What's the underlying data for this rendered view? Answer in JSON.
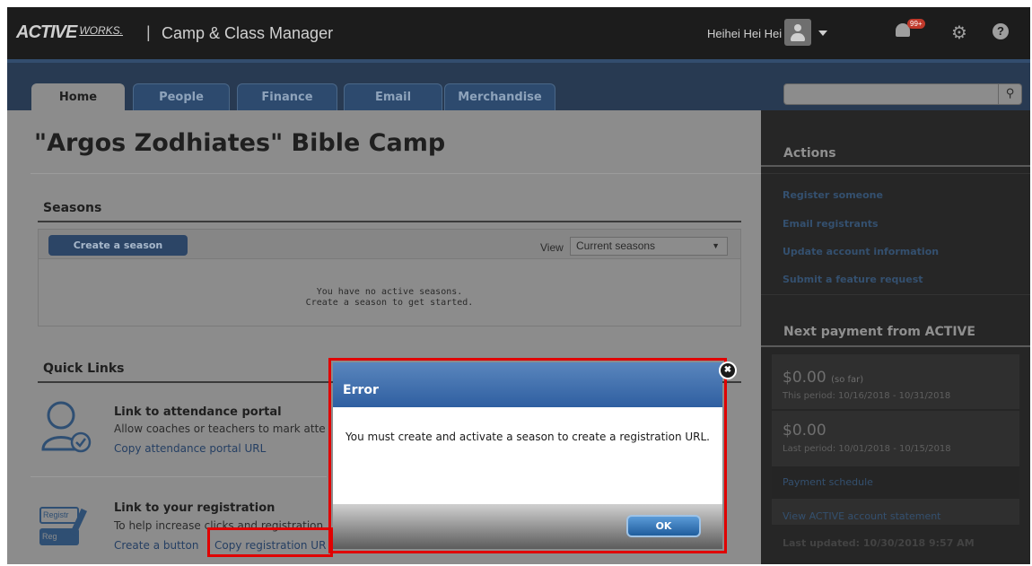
{
  "header": {
    "logo": "ACTIVE",
    "logo_sub": "WORKS.",
    "separator": "|",
    "app_title": "Camp & Class Manager",
    "user_name": "Heihei Hei Hei",
    "notification_count": "99+",
    "help_symbol": "?"
  },
  "nav": {
    "tabs": [
      {
        "label": "Home"
      },
      {
        "label": "People"
      },
      {
        "label": "Finance"
      },
      {
        "label": "Email"
      },
      {
        "label": "Merchandise"
      }
    ],
    "search_placeholder": ""
  },
  "main": {
    "title": "\"Argos Zodhiates\" Bible Camp",
    "seasons": {
      "heading": "Seasons",
      "create_button": "Create a season",
      "view_label": "View",
      "view_selected": "Current seasons",
      "empty_line1": "You have no active seasons.",
      "empty_line2": "Create a season to get started."
    },
    "quick_links": {
      "heading": "Quick Links",
      "attendance": {
        "title": "Link to attendance portal",
        "desc": "Allow coaches or teachers to mark atte",
        "link": "Copy attendance portal URL"
      },
      "registration": {
        "title": "Link to your registration",
        "desc": "To help increase clicks and registration",
        "link_create": "Create a button",
        "link_sep": "|",
        "link_copy": "Copy registration UR",
        "icon_text_1": "Registr",
        "icon_text_2": "Reg"
      }
    }
  },
  "sidebar": {
    "actions_heading": "Actions",
    "actions": [
      "Register someone",
      "Email registrants",
      "Update account information",
      "Submit a feature request"
    ],
    "payment_heading": "Next payment from ACTIVE",
    "current_amount": "$0.00",
    "current_amount_note": "(so far)",
    "current_period": "This period: 10/16/2018 - 10/31/2018",
    "last_amount": "$0.00",
    "last_period": "Last period: 10/01/2018 - 10/15/2018",
    "payment_schedule": "Payment schedule",
    "statement_link": "View ACTIVE account statement",
    "last_updated": "Last updated: 10/30/2018 9:57 AM"
  },
  "dialog": {
    "title": "Error",
    "message": "You must create and activate a season to create a registration URL.",
    "ok_label": "OK"
  },
  "colors": {
    "highlight": "#e00000",
    "dialog_header": "#2f5fa1",
    "overlay_gray": "#8c8c8c"
  }
}
